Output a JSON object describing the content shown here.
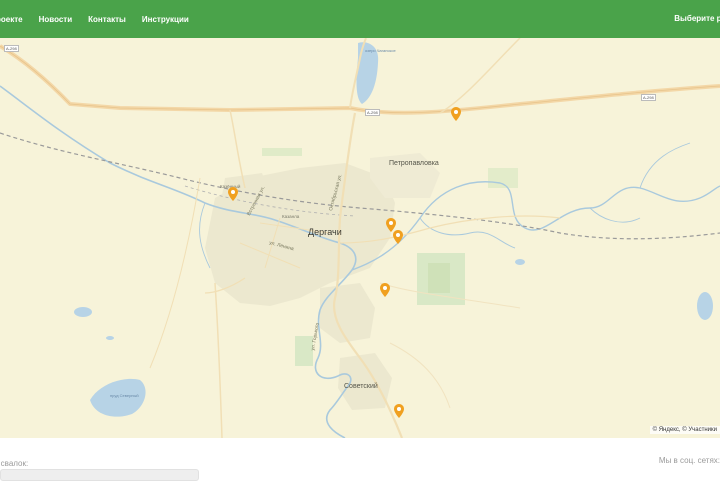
{
  "header": {
    "nav": [
      {
        "label": "роекте",
        "name": "nav-about"
      },
      {
        "label": "Новости",
        "name": "nav-news"
      },
      {
        "label": "Контакты",
        "name": "nav-contacts"
      },
      {
        "label": "Инструкции",
        "name": "nav-instructions"
      }
    ],
    "region_label": "Выберите ре",
    "bg_color": "#4aa34a"
  },
  "map": {
    "labels": {
      "dergachi": "Дергачи",
      "petropavlovka": "Петропавловка",
      "sovetsky": "Советский",
      "kazanla": "Казанла",
      "kazenny": "Казённый",
      "lake_north": "озеро Чаганское",
      "lake_south": "пруд Северный",
      "road_a1": "А-298",
      "road_a2": "А-298",
      "road_a3": "А-298",
      "street_vstrechnaya": "Встречная ул.",
      "street_lenina": "ул. Ленина",
      "street_oktyabrskaya": "Октябрьская ул.",
      "street_gorkogo": "ул. Горького"
    },
    "markers": [
      {
        "name": "marker-1",
        "color": "#f0a020"
      },
      {
        "name": "marker-2",
        "color": "#f0a020"
      },
      {
        "name": "marker-3",
        "color": "#f0a020"
      },
      {
        "name": "marker-4",
        "color": "#f0a020"
      },
      {
        "name": "marker-5",
        "color": "#f0a020"
      },
      {
        "name": "marker-6",
        "color": "#f0a020"
      }
    ],
    "marker_icon": "map-pin",
    "copyright": "© Яндекс, © Участники"
  },
  "footer": {
    "left_label": "а свалок:",
    "right_label": "Мы в соц. сетях:"
  }
}
